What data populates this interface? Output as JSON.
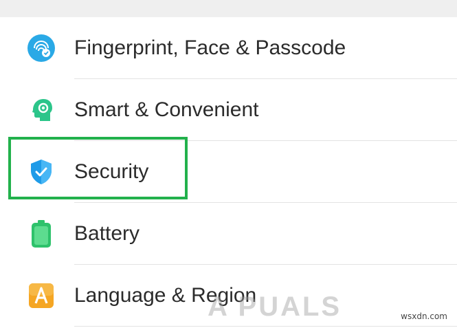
{
  "settings_list": {
    "items": [
      {
        "label": "Fingerprint, Face & Passcode",
        "icon": "fingerprint-face-icon",
        "color": "#2aa9e6"
      },
      {
        "label": "Smart & Convenient",
        "icon": "smart-head-icon",
        "color": "#2cc58a"
      },
      {
        "label": "Security",
        "icon": "shield-check-icon",
        "color": "#1e9be8"
      },
      {
        "label": "Battery",
        "icon": "battery-icon",
        "color": "#2ec26b"
      },
      {
        "label": "Language & Region",
        "icon": "language-a-icon",
        "color": "#f5a623"
      }
    ]
  },
  "highlight": {
    "target": "Security",
    "color": "#22b14c"
  },
  "watermark": {
    "text": "A PUALS"
  },
  "source_tag": {
    "text": "wsxdn.com"
  }
}
